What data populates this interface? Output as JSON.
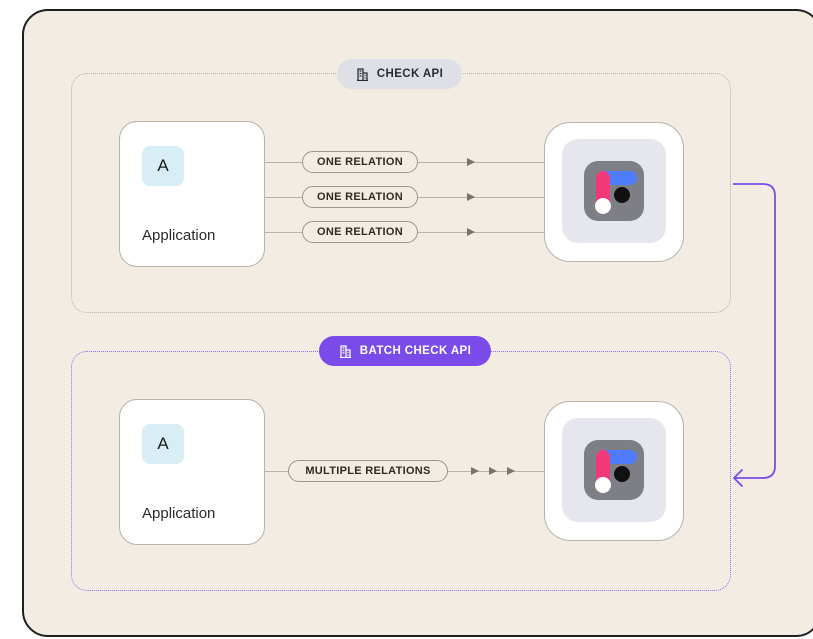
{
  "check_api": {
    "label": "CHECK API",
    "icon": "building-icon",
    "application": {
      "avatar": "A",
      "label": "Application"
    },
    "relations": [
      "ONE RELATION",
      "ONE RELATION",
      "ONE RELATION"
    ]
  },
  "batch_check_api": {
    "label": "BATCH CHECK API",
    "icon": "building-icon",
    "application": {
      "avatar": "A",
      "label": "Application"
    },
    "relation": "MULTIPLE RELATIONS"
  },
  "service_logo": "app-logo-icon",
  "colors": {
    "background": "#f3ece2",
    "accent_purple": "#7a4be8",
    "logo_pink": "#f23a78",
    "logo_blue": "#4f7cff",
    "logo_gray": "#7e7e86"
  }
}
